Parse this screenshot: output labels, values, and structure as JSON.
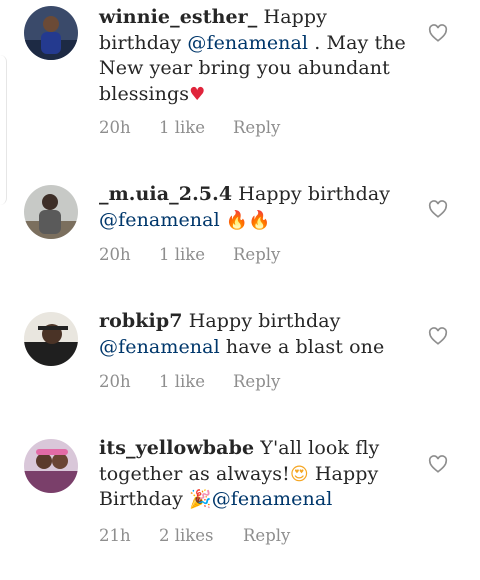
{
  "comments": [
    {
      "username": "winnie_esther_",
      "text_before": " Happy birthday ",
      "mention": "@fenamenal",
      "text_after": " . May the New year bring you abundant blessings",
      "emoji": "♥",
      "time": "20h",
      "likes": "1 like",
      "reply": "Reply"
    },
    {
      "username": "_m.uia_2.5.4",
      "text_before": " Happy birthday ",
      "mention": "@fenamenal",
      "text_after": " ",
      "emoji": "🔥🔥",
      "time": "20h",
      "likes": "1 like",
      "reply": "Reply"
    },
    {
      "username": "robkip7",
      "text_before": " Happy birthday ",
      "mention": "@fenamenal",
      "text_after": "  have a blast one",
      "emoji": "",
      "time": "20h",
      "likes": "1 like",
      "reply": "Reply"
    },
    {
      "username": "its_yellowbabe",
      "text_before": " Y'all look fly together as always!",
      "emoji_mid": "😍",
      "text_mid": " Happy Birthday ",
      "emoji": "🎉",
      "mention": "@fenamenal",
      "time": "21h",
      "likes": "2 likes",
      "reply": "Reply"
    }
  ],
  "icons": {
    "like": "heart-outline-icon"
  },
  "colors": {
    "mention": "#00376b",
    "meta": "#8e8e8e",
    "text": "#262626"
  }
}
